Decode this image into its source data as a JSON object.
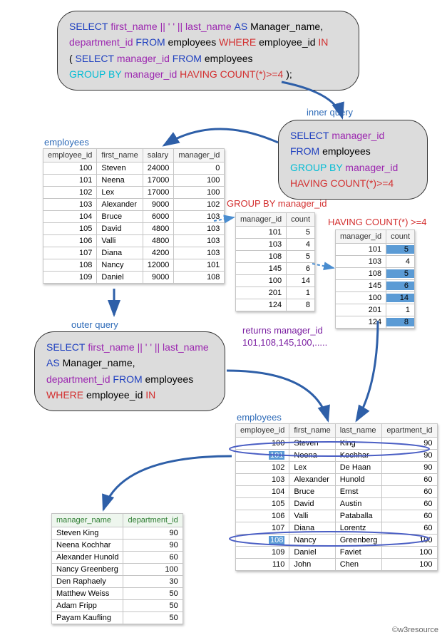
{
  "top_query": {
    "l1_select": "SELECT",
    "l1_expr": " first_name || ' ' || last_name ",
    "l1_as": "AS",
    "l1_alias": " Manager_name,",
    "l2_col": "department_id",
    "l2_from": " FROM",
    "l2_tbl": " employees ",
    "l2_where": "WHERE",
    "l2_cond": " employee_id ",
    "l2_in": "IN",
    "l3_open": "(",
    "l3_select": " SELECT",
    "l3_col": " manager_id",
    "l3_from": " FROM",
    "l3_tbl": " employees",
    "l4_group": "GROUP BY",
    "l4_col": " manager_id",
    "l4_having": " HAVING COUNT(*)>=4",
    "l4_close": " );"
  },
  "labels": {
    "inner_query": "inner query",
    "outer_query": "outer query",
    "employees": "employees",
    "groupby": "GROUP BY manager_id",
    "having": "HAVING COUNT(*) >=4",
    "returns": "returns manager_id 101,108,145,100,.....",
    "footer": "©w3resource"
  },
  "inner_query_box": {
    "l1_select": "SELECT",
    "l1_col": " manager_id",
    "l2_from": "FROM",
    "l2_tbl": " employees",
    "l3_group": "GROUP BY",
    "l3_col": " manager_id",
    "l4_having": "HAVING COUNT(*)>=4"
  },
  "outer_query_box": {
    "l1_select": "SELECT",
    "l1_expr": " first_name || ' ' || last_name",
    "l2_as": "AS",
    "l2_alias": " Manager_name,",
    "l3_col": "department_id",
    "l3_from": " FROM",
    "l3_tbl": " employees",
    "l4_where": "WHERE",
    "l4_cond": " employee_id ",
    "l4_in": "IN"
  },
  "employees_table1": {
    "headers": [
      "employee_id",
      "first_name",
      "salary",
      "manager_id"
    ],
    "rows": [
      [
        "100",
        "Steven",
        "24000",
        "0"
      ],
      [
        "101",
        "Neena",
        "17000",
        "100"
      ],
      [
        "102",
        "Lex",
        "17000",
        "100"
      ],
      [
        "103",
        "Alexander",
        "9000",
        "102"
      ],
      [
        "104",
        "Bruce",
        "6000",
        "103"
      ],
      [
        "105",
        "David",
        "4800",
        "103"
      ],
      [
        "106",
        "Valli",
        "4800",
        "103"
      ],
      [
        "107",
        "Diana",
        "4200",
        "103"
      ],
      [
        "108",
        "Nancy",
        "12000",
        "101"
      ],
      [
        "109",
        "Daniel",
        "9000",
        "108"
      ]
    ]
  },
  "groupby_table": {
    "headers": [
      "manager_id",
      "count"
    ],
    "rows": [
      [
        "101",
        "5"
      ],
      [
        "103",
        "4"
      ],
      [
        "108",
        "5"
      ],
      [
        "145",
        "6"
      ],
      [
        "100",
        "14"
      ],
      [
        "201",
        "1"
      ],
      [
        "124",
        "8"
      ]
    ]
  },
  "having_table": {
    "headers": [
      "manager_id",
      "count"
    ],
    "rows": [
      [
        "101",
        "5"
      ],
      [
        "103",
        "4"
      ],
      [
        "108",
        "5"
      ],
      [
        "145",
        "6"
      ],
      [
        "100",
        "14"
      ],
      [
        "201",
        "1"
      ],
      [
        "124",
        "8"
      ]
    ],
    "hl_idx": [
      0,
      2,
      3,
      4,
      6
    ]
  },
  "employees_table2": {
    "headers": [
      "employee_id",
      "first_name",
      "last_name",
      "epartment_id"
    ],
    "rows": [
      [
        "100",
        "Steven",
        "King",
        "90"
      ],
      [
        "101",
        "Neena",
        "Kochhar",
        "90"
      ],
      [
        "102",
        "Lex",
        "De Haan",
        "90"
      ],
      [
        "103",
        "Alexander",
        "Hunold",
        "60"
      ],
      [
        "104",
        "Bruce",
        "Ernst",
        "60"
      ],
      [
        "105",
        "David",
        "Austin",
        "60"
      ],
      [
        "106",
        "Valli",
        "Pataballa",
        "60"
      ],
      [
        "107",
        "Diana",
        "Lorentz",
        "60"
      ],
      [
        "108",
        "Nancy",
        "Greenberg",
        "100"
      ],
      [
        "109",
        "Daniel",
        "Faviet",
        "100"
      ],
      [
        "110",
        "John",
        "Chen",
        "100"
      ]
    ],
    "hl_rows": [
      1,
      8
    ]
  },
  "result_table": {
    "headers": [
      "manager_name",
      "department_id"
    ],
    "rows": [
      [
        "Steven King",
        "90"
      ],
      [
        "Neena Kochhar",
        "90"
      ],
      [
        "Alexander Hunold",
        "60"
      ],
      [
        "Nancy Greenberg",
        "100"
      ],
      [
        "Den Raphaely",
        "30"
      ],
      [
        "Matthew Weiss",
        "50"
      ],
      [
        "Adam Fripp",
        "50"
      ],
      [
        "Payam Kaufling",
        "50"
      ]
    ]
  }
}
